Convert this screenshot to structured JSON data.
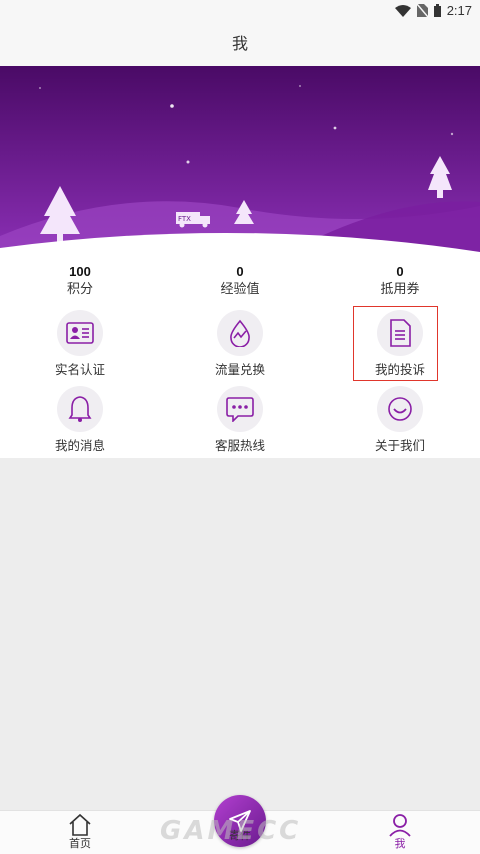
{
  "status_bar": {
    "time": "2:17",
    "icons": [
      "wifi-icon",
      "no-sim-icon",
      "battery-icon"
    ]
  },
  "header": {
    "title": "我"
  },
  "banner": {
    "truck_text": "FTX"
  },
  "stats": [
    {
      "value": "100",
      "label": "积分"
    },
    {
      "value": "0",
      "label": "经验值"
    },
    {
      "value": "0",
      "label": "抵用券"
    }
  ],
  "menu": [
    {
      "label": "实名认证",
      "icon": "id-card-icon"
    },
    {
      "label": "流量兑换",
      "icon": "traffic-icon"
    },
    {
      "label": "我的投诉",
      "icon": "document-icon",
      "highlighted": true
    },
    {
      "label": "我的消息",
      "icon": "bell-icon"
    },
    {
      "label": "客服热线",
      "icon": "chat-bubble-icon"
    },
    {
      "label": "关于我们",
      "icon": "smile-icon"
    }
  ],
  "tabbar": {
    "home": "首页",
    "center": "寄件",
    "me": "我",
    "active": "me"
  },
  "watermark": "GAMECC",
  "colors": {
    "accent": "#8a1fa6",
    "banner_top": "#4a0a66",
    "banner_bottom": "#8b2fb5",
    "highlight": "#e0362c"
  }
}
